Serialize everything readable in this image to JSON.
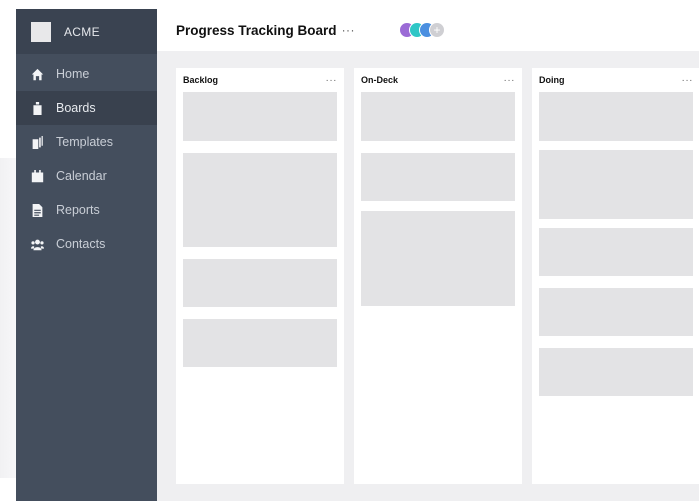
{
  "sidebar": {
    "brand": "ACME",
    "items": [
      {
        "label": "Home",
        "icon": "home-icon",
        "active": false
      },
      {
        "label": "Boards",
        "icon": "boards-icon",
        "active": true
      },
      {
        "label": "Templates",
        "icon": "templates-icon",
        "active": false
      },
      {
        "label": "Calendar",
        "icon": "calendar-icon",
        "active": false
      },
      {
        "label": "Reports",
        "icon": "reports-icon",
        "active": false
      },
      {
        "label": "Contacts",
        "icon": "contacts-icon",
        "active": false
      }
    ]
  },
  "board": {
    "title": "Progress Tracking Board",
    "more": "···",
    "members": [
      {
        "color": "#9b6bd6"
      },
      {
        "color": "#2fc6c6"
      },
      {
        "color": "#4a8fe0"
      }
    ],
    "add_member": "+"
  },
  "columns": [
    {
      "title": "Backlog",
      "more": "···",
      "cards": 4
    },
    {
      "title": "On-Deck",
      "more": "···",
      "cards": 3
    },
    {
      "title": "Doing",
      "more": "···",
      "cards": 5
    }
  ],
  "colors": {
    "sidebar": "#444e5d",
    "sidebar_header": "#3a4351",
    "active_item": "#39414e",
    "canvas": "#efeff1",
    "card": "#e3e3e5"
  }
}
